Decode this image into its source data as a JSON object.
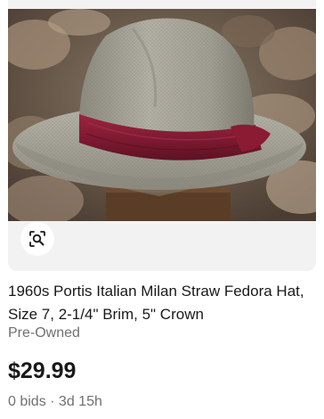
{
  "listing": {
    "title": "1960s Portis Italian Milan Straw Fedora Hat, Size 7, 2-1/4\" Brim, 5\" Crown",
    "condition": "Pre-Owned",
    "price": "$29.99",
    "bids": "0 bids",
    "separator": " · ",
    "time_left": "3d 15h"
  },
  "icons": {
    "visual_search": "visual-search-icon",
    "watch": "heart-icon"
  },
  "colors": {
    "text_primary": "#191919",
    "text_secondary": "#707070",
    "hat_band": "#8a1b32",
    "image_bg": "#f2f2f2"
  }
}
